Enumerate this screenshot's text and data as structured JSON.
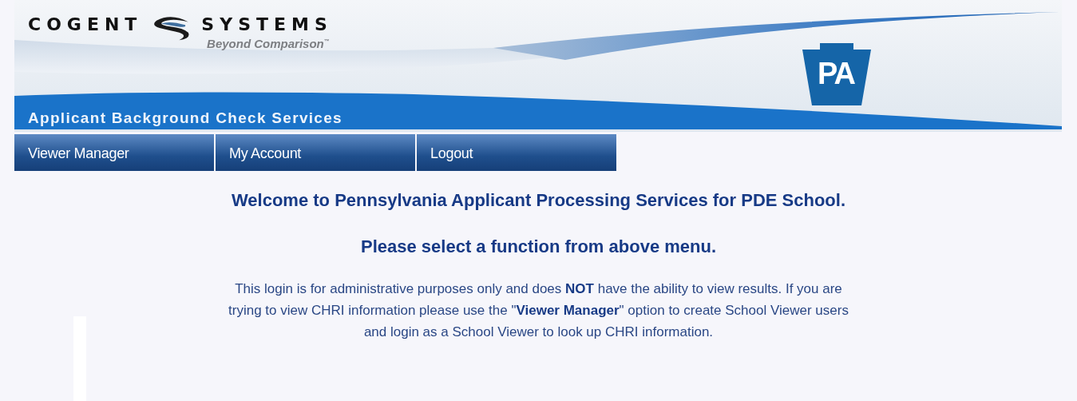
{
  "header": {
    "brand_left": "COGENT",
    "brand_right": "SYSTEMS",
    "tagline": "Beyond Comparison$^{™}$",
    "state_badge": "PA",
    "title": "Applicant Background Check Services"
  },
  "menu": [
    {
      "label": "Viewer Manager"
    },
    {
      "label": "My Account"
    },
    {
      "label": "Logout"
    }
  ],
  "content": {
    "headings": [
      "Welcome to Pennsylvania Applicant Processing Services for PDE School.",
      "Please select a function from above menu."
    ],
    "notice": "This login is for administrative purposes only and does **NOT** have the ability to view results. If you are trying to view CHRI information please use the \"**Viewer Manager**\" option to create School Viewer users and login as a School Viewer to look up CHRI information."
  }
}
